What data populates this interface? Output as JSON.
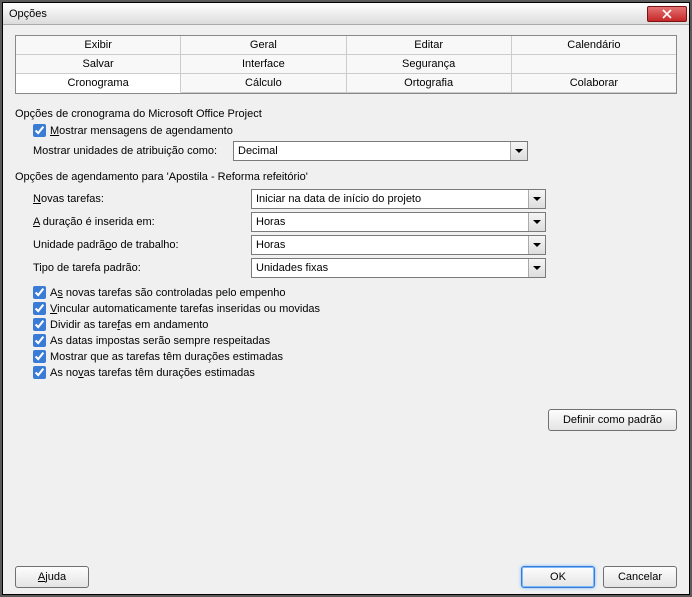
{
  "window": {
    "title": "Opções"
  },
  "tabs": {
    "row1": [
      "Exibir",
      "Geral",
      "Editar",
      "Calendário"
    ],
    "row2": [
      "Salvar",
      "Interface",
      "Segurança",
      ""
    ],
    "row3": [
      "Cronograma",
      "Cálculo",
      "Ortografia",
      "Colaborar"
    ]
  },
  "section1_title": "Opções de cronograma do Microsoft Office Project",
  "chk_show_scheduling_msgs": "ostrar mensagens de agendamento",
  "lbl_show_assignment_units": "Mostrar unidades de atribuição como:",
  "val_show_assignment_units": "Decimal",
  "section2_title": "Opções de agendamento para 'Apostila - Reforma refeitório'",
  "rows": {
    "new_tasks_lbl": "ovas tarefas:",
    "new_tasks_val": "Iniciar na data de início do projeto",
    "duration_lbl": " duração é inserida em:",
    "duration_val": "Horas",
    "work_unit_lbl": "o de trabalho:",
    "work_unit_prefix": "Unidade padrã",
    "work_unit_val": "Horas",
    "task_type_lbl": "Tipo de tarefa padrão:",
    "task_type_val": "Unidades fixas"
  },
  "checks": {
    "c1_prefix": "A",
    "c1": " novas tarefas são controladas pelo empenho",
    "c2": "incular automaticamente tarefas inseridas ou movidas",
    "c3_prefix": "Dividir as tare",
    "c3": "as em andamento",
    "c4": "As datas impostas serão sempre respeitadas",
    "c5": "Mostrar que as tarefas têm durações estimadas",
    "c6_prefix": "As no",
    "c6": "as tarefas têm durações estimadas"
  },
  "buttons": {
    "set_default": "Definir como padrão",
    "help": "Ajuda",
    "ok": "OK",
    "cancel": "Cancelar"
  }
}
